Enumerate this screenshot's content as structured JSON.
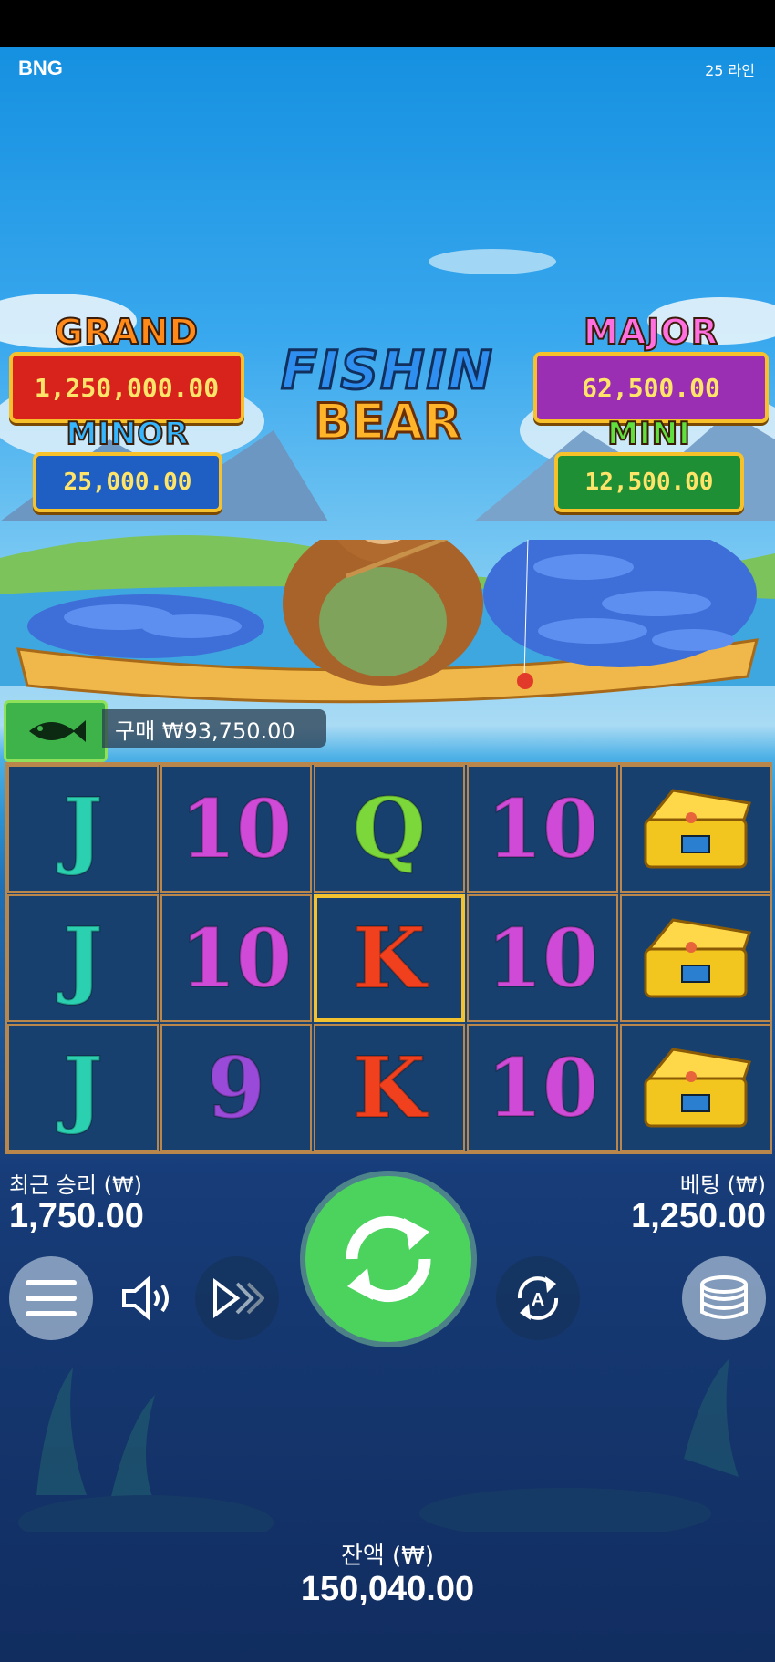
{
  "header": {
    "brand": "BNG",
    "lines": "25 라인"
  },
  "jackpots": {
    "grand": {
      "title": "GRAND",
      "value": "1,250,000.00"
    },
    "major": {
      "title": "MAJOR",
      "value": "62,500.00"
    },
    "minor": {
      "title": "MINOR",
      "value": "25,000.00"
    },
    "mini": {
      "title": "MINI",
      "value": "12,500.00"
    }
  },
  "logo": {
    "line1": "FISHIN",
    "line2": "BEAR"
  },
  "buy": {
    "label": "구매 ₩93,750.00",
    "icon": "fish-icon"
  },
  "reels": {
    "rows": [
      [
        "J",
        "10",
        "Q",
        "10",
        "chest"
      ],
      [
        "J",
        "10",
        "K",
        "10",
        "chest"
      ],
      [
        "J",
        "9",
        "K",
        "10",
        "chest"
      ]
    ],
    "highlighted": "row 2, reel 3"
  },
  "stats": {
    "last_win_label": "최근 승리 (₩)",
    "last_win": "1,750.00",
    "bet_label": "베팅 (₩)",
    "bet": "1,250.00",
    "balance_label": "잔액 (₩)",
    "balance": "150,040.00"
  },
  "controls": [
    "menu-icon",
    "sound-icon",
    "turbo-icon",
    "spin-icon",
    "autoplay-icon",
    "coins-icon"
  ],
  "colors": {
    "spin": "#4cd35e",
    "grand": "#d8231d",
    "major": "#9a2fb4",
    "minor": "#1f5fc4",
    "mini": "#1f8f35"
  }
}
